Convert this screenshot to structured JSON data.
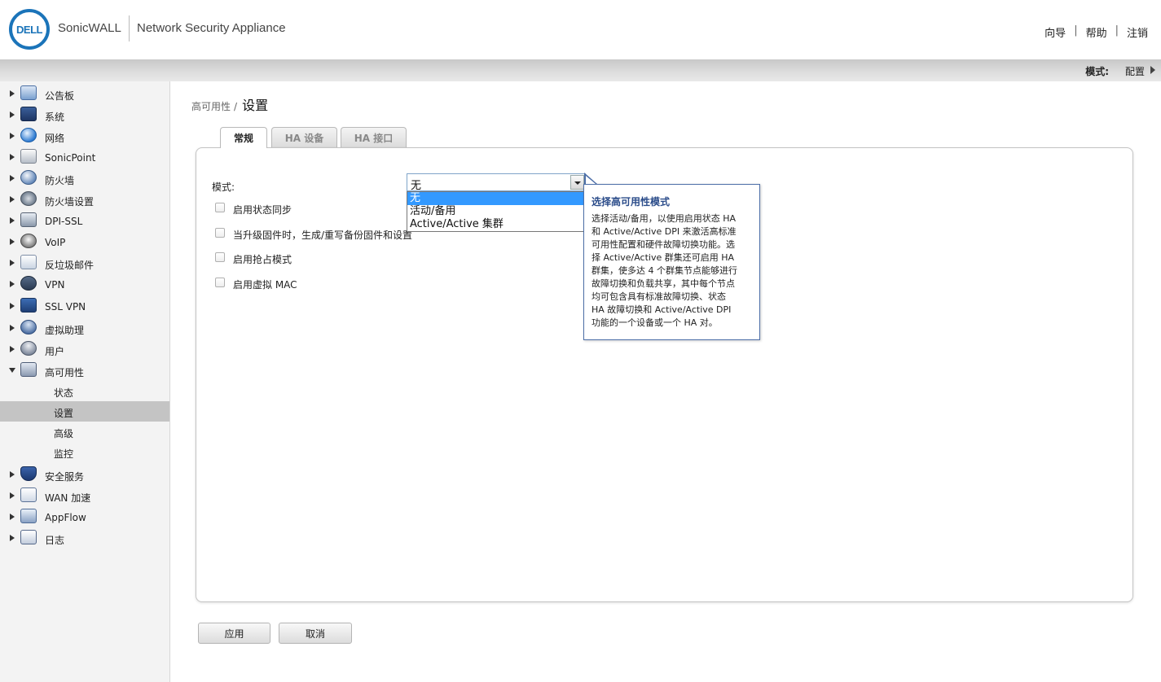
{
  "header": {
    "logo_text": "DELL",
    "brand": "SonicWALL",
    "product": "Network Security Appliance",
    "links": [
      "向导",
      "帮助",
      "注销"
    ]
  },
  "modebar": {
    "label": "模式:",
    "value": "配置"
  },
  "sidebar": {
    "items": [
      {
        "label": "公告板"
      },
      {
        "label": "系统"
      },
      {
        "label": "网络"
      },
      {
        "label": "SonicPoint"
      },
      {
        "label": "防火墙"
      },
      {
        "label": "防火墙设置"
      },
      {
        "label": "DPI-SSL"
      },
      {
        "label": "VoIP"
      },
      {
        "label": "反垃圾邮件"
      },
      {
        "label": "VPN"
      },
      {
        "label": "SSL VPN"
      },
      {
        "label": "虚拟助理"
      },
      {
        "label": "用户"
      },
      {
        "label": "高可用性"
      },
      {
        "label": "安全服务"
      },
      {
        "label": "WAN 加速"
      },
      {
        "label": "AppFlow"
      },
      {
        "label": "日志"
      }
    ],
    "subitems": [
      {
        "label": "状态"
      },
      {
        "label": "设置"
      },
      {
        "label": "高级"
      },
      {
        "label": "监控"
      }
    ]
  },
  "breadcrumb": {
    "parent": "高可用性",
    "current": "设置"
  },
  "tabs": [
    {
      "label": "常规"
    },
    {
      "label": "HA 设备"
    },
    {
      "label": "HA 接口"
    }
  ],
  "form": {
    "mode_label": "模式:",
    "mode_value": "无",
    "mode_options": [
      "无",
      "活动/备用",
      "Active/Active 集群"
    ],
    "checkboxes": [
      {
        "label": "启用状态同步",
        "checked": false
      },
      {
        "label": "当升级固件时，生成/重写备份固件和设置",
        "checked": false
      },
      {
        "label": "启用抢占模式",
        "checked": false
      },
      {
        "label": "启用虚拟 MAC",
        "checked": false
      }
    ]
  },
  "tooltip": {
    "title": "选择高可用性模式",
    "lines": [
      "选择活动/备用，以使用启用状态 HA",
      "和 Active/Active DPI 来激活高标准",
      "可用性配置和硬件故障切换功能。选",
      "择 Active/Active 群集还可启用 HA",
      "群集，使多达 4 个群集节点能够进行",
      "故障切换和负载共享，其中每个节点",
      "均可包含具有标准故障切换、状态",
      "HA 故障切换和 Active/Active DPI",
      "功能的一个设备或一个 HA 对。"
    ]
  },
  "buttons": {
    "apply": "应用",
    "cancel": "取消"
  }
}
